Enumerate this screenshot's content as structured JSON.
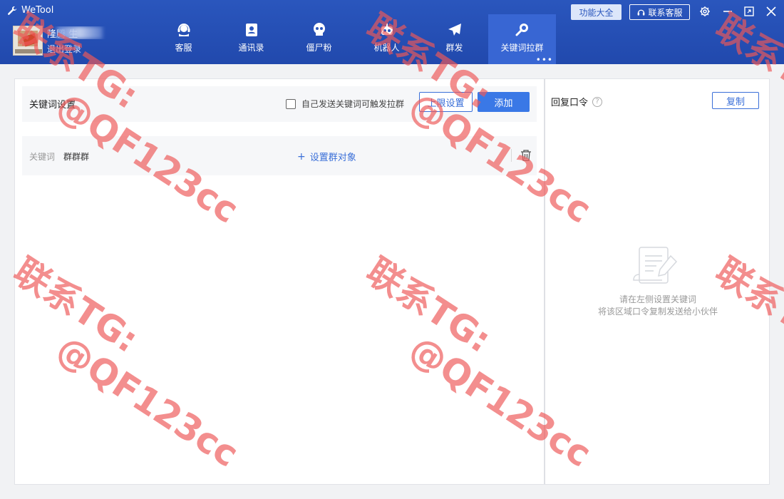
{
  "app": {
    "title": "WeTool"
  },
  "user": {
    "name": "隆腾 生",
    "logout_label": "退出登录"
  },
  "nav": {
    "items": [
      {
        "label": "客服",
        "icon": "headset-icon"
      },
      {
        "label": "通讯录",
        "icon": "contacts-icon"
      },
      {
        "label": "僵尸粉",
        "icon": "skull-icon"
      },
      {
        "label": "机器人",
        "icon": "robot-icon"
      },
      {
        "label": "群发",
        "icon": "send-icon"
      },
      {
        "label": "关键词拉群",
        "icon": "search-icon",
        "active": true
      }
    ],
    "more": "•••"
  },
  "top_buttons": {
    "func_label": "功能大全",
    "contact_label": "联系客服"
  },
  "keyword_panel": {
    "title": "关键词设置",
    "auto_trigger_label": "自己发送关键词可触发拉群",
    "auto_trigger_checked": false,
    "limit_button": "上限设置",
    "add_button": "添加",
    "rows": [
      {
        "label": "关键词",
        "value": "群群群",
        "action_label": "设置群对象"
      }
    ]
  },
  "reply_panel": {
    "title": "回复口令",
    "help": "?",
    "copy_button": "复制",
    "empty_line1": "请在左侧设置关键词",
    "empty_line2": "将该区域口令复制发送给小伙伴"
  },
  "watermark": {
    "line1": "联系TG:",
    "line2": "@QF123cc"
  },
  "colors": {
    "header": "#2149ad",
    "accent": "#3a78e6",
    "watermark": "#ee5858"
  }
}
